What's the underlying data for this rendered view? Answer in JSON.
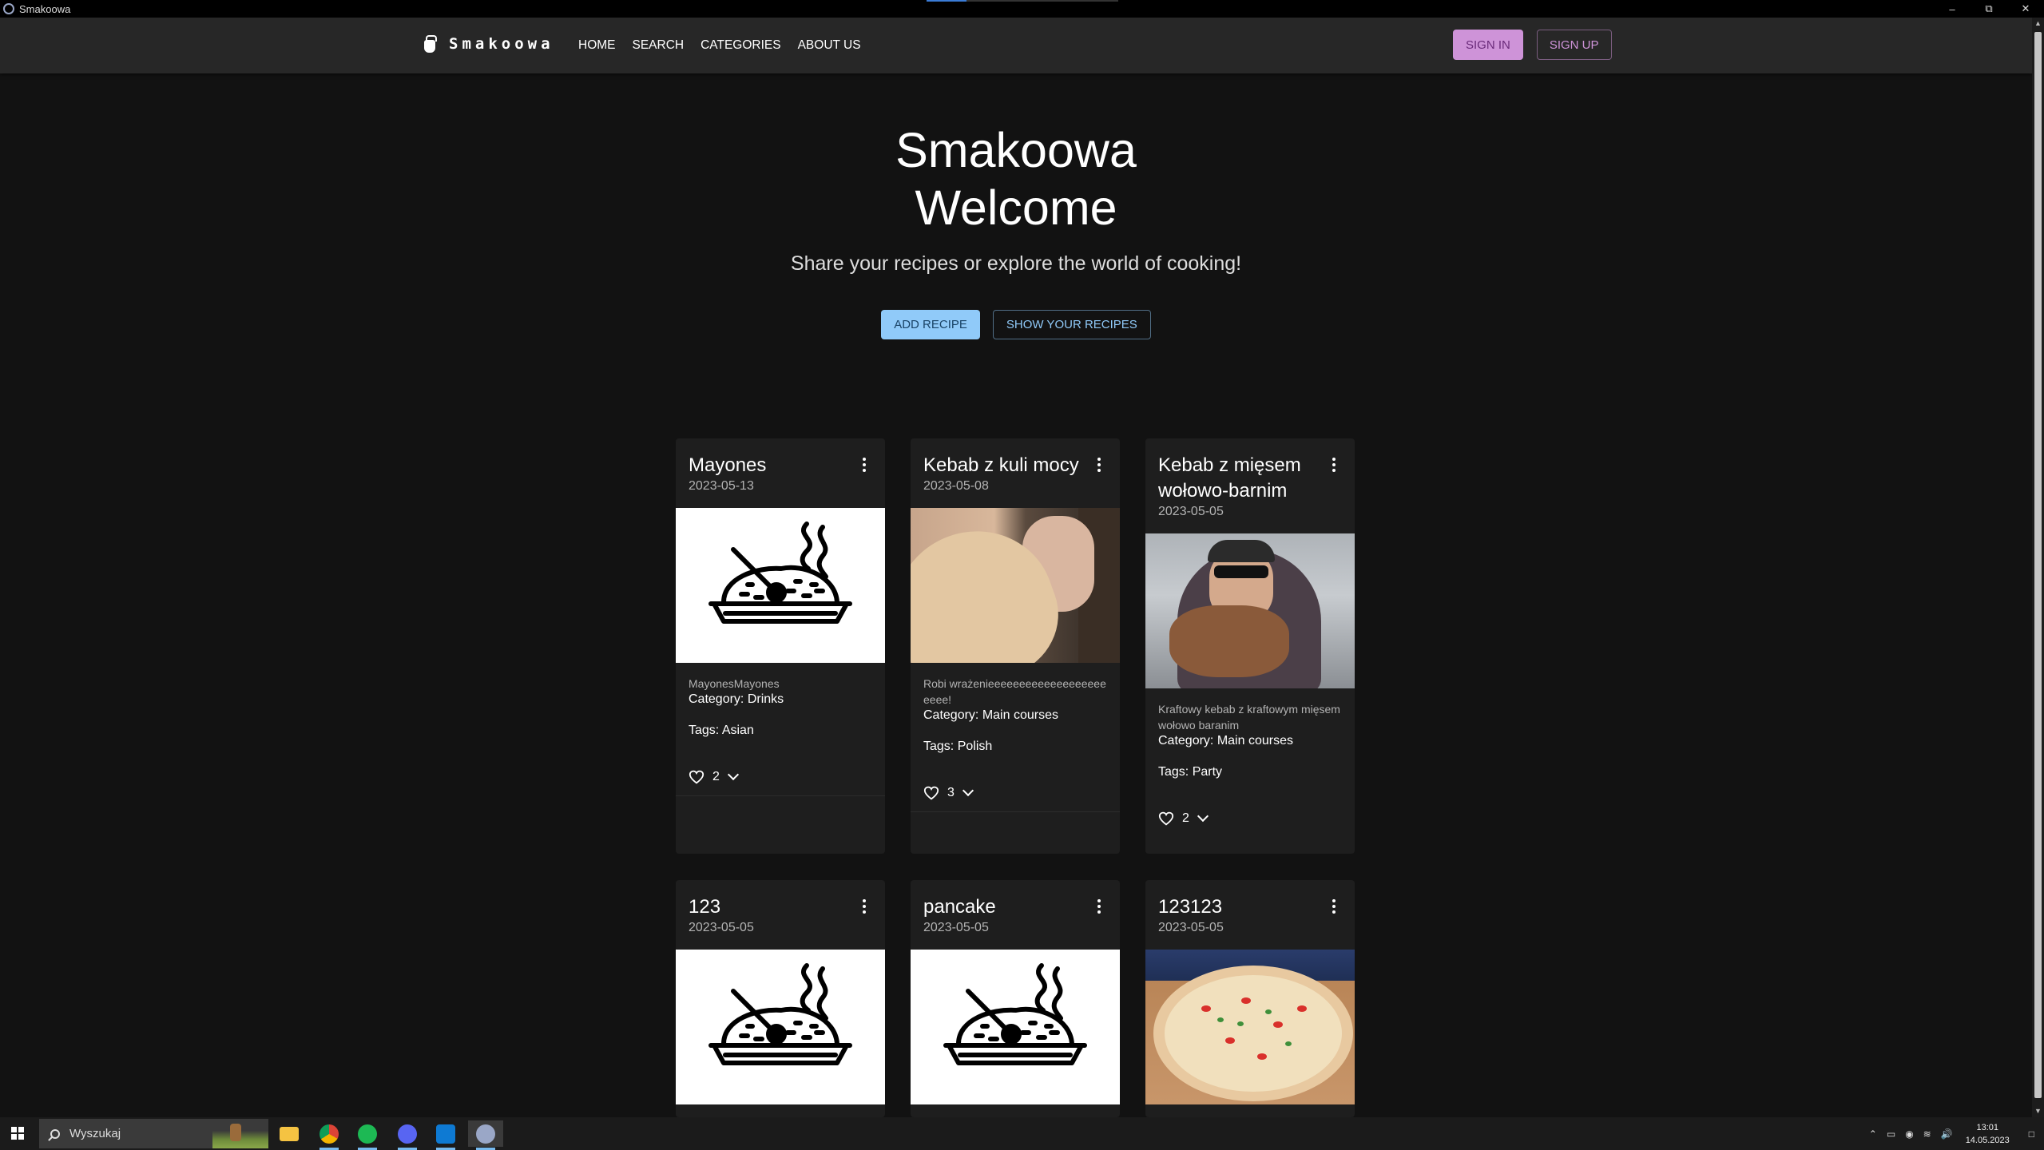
{
  "window": {
    "title": "Smakoowa"
  },
  "navbar": {
    "brand": "Smakoowa",
    "links": [
      "HOME",
      "SEARCH",
      "CATEGORIES",
      "ABOUT US"
    ],
    "sign_in": "SIGN IN",
    "sign_up": "SIGN UP"
  },
  "hero": {
    "title_line1": "Smakoowa",
    "title_line2": "Welcome",
    "subtitle": "Share your recipes or explore the world of cooking!",
    "add_recipe": "ADD RECIPE",
    "show_recipes": "SHOW YOUR RECIPES"
  },
  "recipes": [
    {
      "title": "Mayones",
      "date": "2023-05-13",
      "image": "placeholder",
      "description": "MayonesMayones",
      "category_label": "Category:",
      "category": "Drinks",
      "tags_label": "Tags:",
      "tags": "Asian",
      "likes": "2"
    },
    {
      "title": "Kebab z kuli mocy",
      "date": "2023-05-08",
      "image": "photo-kebab-selfie",
      "description": "Robi wrażenieeeeeeeeeeeeeeeeeeeeeee!",
      "category_label": "Category:",
      "category": "Main courses",
      "tags_label": "Tags:",
      "tags": "Polish",
      "likes": "3"
    },
    {
      "title": "Kebab z mięsem wołowo-barnim",
      "date": "2023-05-05",
      "image": "photo-kebab-street",
      "description": "Kraftowy kebab z kraftowym mięsem wołowo baranim",
      "category_label": "Category:",
      "category": "Main courses",
      "tags_label": "Tags:",
      "tags": "Party",
      "likes": "2"
    },
    {
      "title": "123",
      "date": "2023-05-05",
      "image": "placeholder"
    },
    {
      "title": "pancake",
      "date": "2023-05-05",
      "image": "placeholder"
    },
    {
      "title": "123123",
      "date": "2023-05-05",
      "image": "photo-pizza"
    }
  ],
  "taskbar": {
    "search_placeholder": "Wyszukaj",
    "time": "13:01",
    "date": "14.05.2023",
    "apps": [
      "file-explorer",
      "chrome",
      "spotify",
      "discord",
      "vscode",
      "electron-app"
    ]
  },
  "colors": {
    "background": "#121212",
    "appbar": "#272727",
    "card": "#1e1e1e",
    "primary": "#90caf9",
    "secondary": "#ce93d8"
  }
}
